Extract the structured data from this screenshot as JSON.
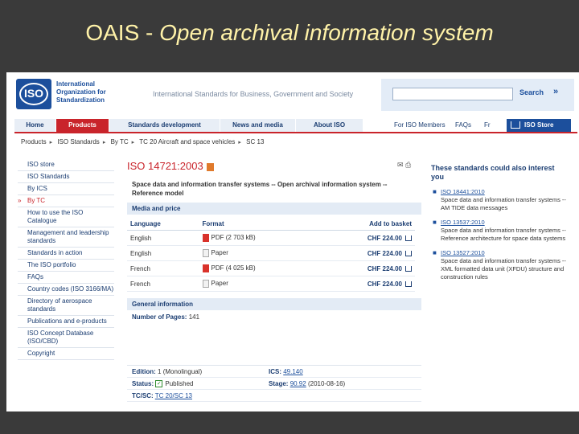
{
  "slide": {
    "title_plain": "OAIS - ",
    "title_italic": "Open archival information system"
  },
  "header": {
    "logo_text": "ISO",
    "org_name": "International Organization for Standardization",
    "tagline": "International Standards for Business, Government and Society",
    "search_placeholder": "",
    "search_label": "Search",
    "search_arrow": "»"
  },
  "nav": {
    "items": [
      "Home",
      "Products",
      "Standards development",
      "News and media",
      "About ISO"
    ],
    "links": [
      "For ISO Members",
      "FAQs",
      "Fr"
    ],
    "store_label": "ISO Store"
  },
  "breadcrumb": [
    "Products",
    "ISO Standards",
    "By TC",
    "TC 20 Aircraft and space vehicles",
    "SC 13"
  ],
  "sidebar": {
    "items": [
      {
        "label": "ISO store"
      },
      {
        "label": "ISO Standards"
      },
      {
        "label": "By ICS"
      },
      {
        "label": "By TC",
        "active": true
      },
      {
        "label": "How to use the ISO Catalogue"
      },
      {
        "label": "Management and leadership standards"
      },
      {
        "label": "Standards in action"
      },
      {
        "label": "The ISO portfolio"
      },
      {
        "label": "FAQs"
      },
      {
        "label": "Country codes (ISO 3166/MA)"
      },
      {
        "label": "Directory of aerospace standards"
      },
      {
        "label": "Publications and e-products"
      },
      {
        "label": "ISO Concept Database (ISO/CBD)"
      },
      {
        "label": "Copyright"
      }
    ]
  },
  "product": {
    "title": "ISO 14721:2003",
    "tools": "✉ ⎙",
    "description": "Space data and information transfer systems -- Open archival information system -- Reference model",
    "media_heading": "Media and price",
    "columns": [
      "Language",
      "Format",
      "Add to basket"
    ],
    "rows": [
      {
        "language": "English",
        "format": "PDF (2 703 kB)",
        "icon": "pdf",
        "price": "CHF 224.00"
      },
      {
        "language": "English",
        "format": "Paper",
        "icon": "paper",
        "price": "CHF 224.00"
      },
      {
        "language": "French",
        "format": "PDF (4 025 kB)",
        "icon": "pdf",
        "price": "CHF 224.00"
      },
      {
        "language": "French",
        "format": "Paper",
        "icon": "paper",
        "price": "CHF 224.00"
      }
    ],
    "general_heading": "General information",
    "pages_label": "Number of Pages:",
    "pages_value": "141",
    "edition_label": "Edition:",
    "edition_value": "1 (Monolingual)",
    "ics_label": "ICS:",
    "ics_value": "49.140",
    "status_label": "Status:",
    "status_value": "Published",
    "stage_label": "Stage:",
    "stage_link": "90.92",
    "stage_date": "(2010-08-16)",
    "tcsc_label": "TC/SC:",
    "tcsc_value": "TC 20/SC 13"
  },
  "recommendations": {
    "heading": "These standards could also interest you",
    "items": [
      {
        "code": "ISO 18441:2010",
        "text": "Space data and information transfer systems -- AM TIDE data messages"
      },
      {
        "code": "ISO 13537:2010",
        "text": "Space data and information transfer systems -- Reference architecture for space data systems"
      },
      {
        "code": "ISO 13527:2010",
        "text": "Space data and information transfer systems -- XML formatted data unit (XFDU) structure and construction rules"
      }
    ]
  },
  "colors": {
    "accent": "#c9242b",
    "brand": "#1c4f9c",
    "title": "#fff2a8"
  }
}
